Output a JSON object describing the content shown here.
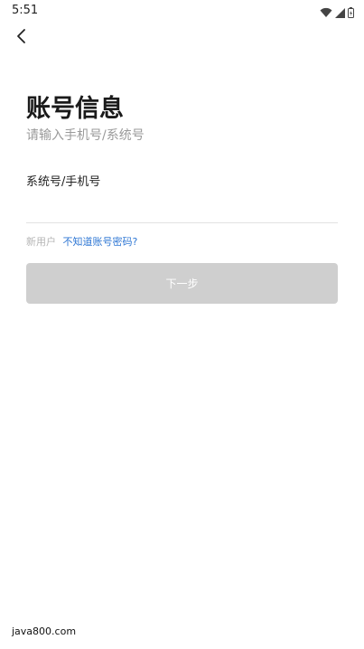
{
  "status_bar": {
    "time": "5:51",
    "icons": [
      "wifi-icon",
      "cellular-signal-icon",
      "battery-icon"
    ]
  },
  "header": {
    "back_icon": "chevron-left-icon"
  },
  "main": {
    "title": "账号信息",
    "subtitle": "请输入手机号/系统号",
    "field_label": "系统号/手机号",
    "field_value": "",
    "new_user_text": "新用户",
    "forgot_link": "不知道账号密码?",
    "next_button": "下一步"
  },
  "colors": {
    "button_disabled": "#cfcfcf",
    "link": "#2f77d4",
    "subtitle": "#9a9a9a"
  },
  "watermark": "java800.com"
}
